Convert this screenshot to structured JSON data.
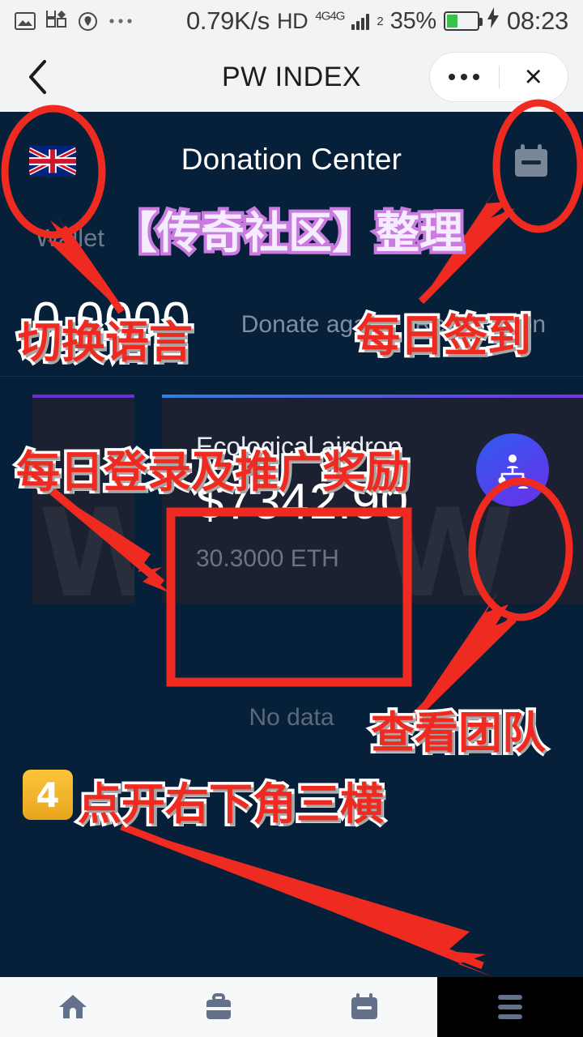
{
  "statusbar": {
    "icons": [
      "image-icon",
      "apps-icon",
      "location-icon",
      "more-icon"
    ],
    "netspeed": "0.79K/s",
    "hd": "HD",
    "network_1": "4G",
    "network_2": "4G",
    "signal_sub": "2",
    "battery_percent": "35%",
    "charging": true,
    "clock": "08:23"
  },
  "navbar": {
    "back_icon": "chevron-left-icon",
    "title": "PW INDEX",
    "menu_icon": "more-dots-icon",
    "close_label": "×"
  },
  "app": {
    "language_flag": "uk-flag",
    "title": "Donation Center",
    "checkin_icon": "calendar-icon",
    "wallet": {
      "label": "Wallet",
      "amount": "0.0000",
      "actions": [
        "Donate again",
        "Redemption"
      ]
    },
    "cards": [
      {
        "title": "",
        "amount": "",
        "sub": "",
        "accent": "#6c2fd6",
        "watermark": "W"
      },
      {
        "title": "Ecological airdrop",
        "amount": "$7342.90",
        "sub": "30.3000 ETH",
        "accent": "#2f7fe0",
        "watermark": "W"
      }
    ],
    "team_icon": "team-network-icon",
    "empty_state": "No data"
  },
  "tabbar": {
    "items": [
      {
        "icon": "home-icon",
        "active": false
      },
      {
        "icon": "briefcase-icon",
        "active": false
      },
      {
        "icon": "calendar-icon",
        "active": false
      },
      {
        "icon": "hamburger-menu-icon",
        "active": true
      }
    ]
  },
  "annotations": {
    "watermark_title": "【传奇社区】整理",
    "switch_language": "切换语言",
    "daily_checkin": "每日签到",
    "daily_login_reward": "每日登录及推广奖励",
    "view_team": "查看团队",
    "tap_hamburger": "点开右下角三横",
    "step_number": "4",
    "marker_color": "#ef2a21",
    "badge_color": "#f0ab1f"
  }
}
